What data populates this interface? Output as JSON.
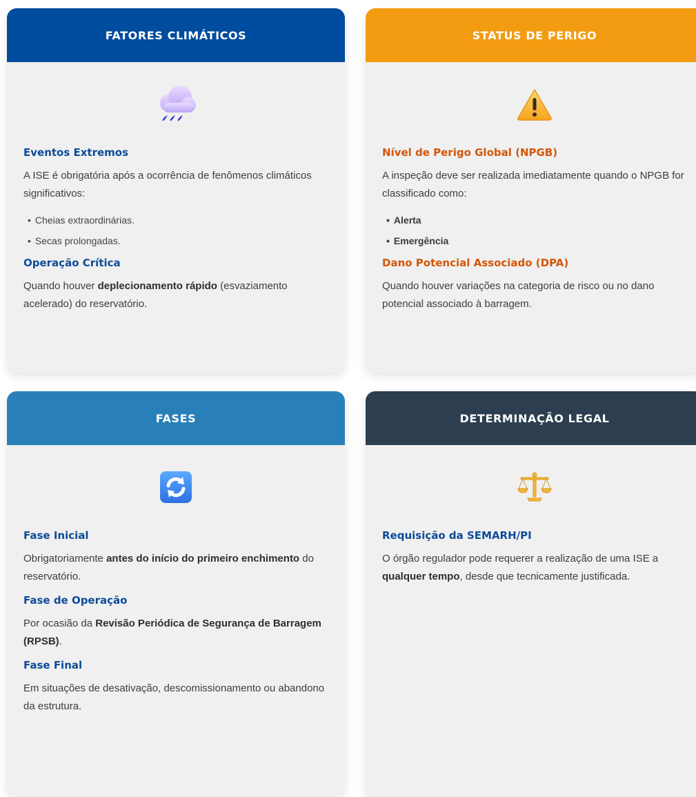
{
  "cards": {
    "climatic": {
      "header": "FATORES CLIMÁTICOS",
      "header_color": "#004c9e",
      "icon": "rain-cloud-icon",
      "sec1_title": "Eventos Extremos",
      "sec1_text": "A ISE é obrigatória após a ocorrência de fenômenos climáticos significativos:",
      "items": [
        "Cheias extraordinárias.",
        "Secas prolongadas."
      ],
      "sec2_title": "Operação Crítica",
      "sec2_pre": "Quando houver ",
      "sec2_bold": "deplecionamento rápido",
      "sec2_post": " (esvaziamento acelerado) do reservatório."
    },
    "danger": {
      "header": "STATUS DE PERIGO",
      "header_color": "#f39c12",
      "icon": "warning-icon",
      "sec1_title": "Nível de Perigo Global (NPGB)",
      "sec1_text": "A inspeção deve ser realizada imediatamente quando o NPGB for classificado como:",
      "items": [
        "Alerta",
        "Emergência"
      ],
      "sec2_title": "Dano Potencial Associado (DPA)",
      "sec2_text": "Quando houver variações na categoria de risco ou no dano potencial associado à barragem."
    },
    "phases": {
      "header": "FASES",
      "header_color": "#2980b9",
      "icon": "refresh-icon",
      "sec1_title": "Fase Inicial",
      "sec1_pre": "Obrigatoriamente ",
      "sec1_bold": "antes do início do primeiro enchimento",
      "sec1_post": " do reservatório.",
      "sec2_title": "Fase de Operação",
      "sec2_pre": "Por ocasião da ",
      "sec2_bold": "Revisão Periódica de Segurança de Barragem (RPSB)",
      "sec2_post": ".",
      "sec3_title": "Fase Final",
      "sec3_text": "Em situações de desativação, descomissionamento ou abandono da estrutura."
    },
    "legal": {
      "header": "DETERMINAÇÃO LEGAL",
      "header_color": "#2c3e50",
      "icon": "scales-icon",
      "sec1_title": "Requisição da SEMARH/PI",
      "sec1_pre": "O órgão regulador pode requerer a realização de uma ISE a ",
      "sec1_bold": "qualquer tempo",
      "sec1_post": ", desde que tecnicamente justificada."
    }
  }
}
